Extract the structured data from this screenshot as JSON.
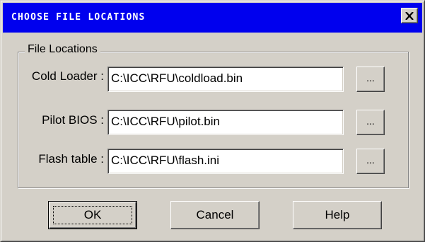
{
  "window": {
    "title": "CHOOSE FILE LOCATIONS",
    "titlebar_color": "#0000ee",
    "close_icon": "close-x-icon"
  },
  "group": {
    "legend": "File Locations",
    "rows": [
      {
        "label": "Cold Loader :",
        "value": "C:\\ICC\\RFU\\coldload.bin",
        "browse_label": "..."
      },
      {
        "label": "Pilot BIOS :",
        "value": "C:\\ICC\\RFU\\pilot.bin",
        "browse_label": "..."
      },
      {
        "label": "Flash table :",
        "value": "C:\\ICC\\RFU\\flash.ini",
        "browse_label": "..."
      }
    ]
  },
  "buttons": {
    "ok": "OK",
    "cancel": "Cancel",
    "help": "Help"
  }
}
